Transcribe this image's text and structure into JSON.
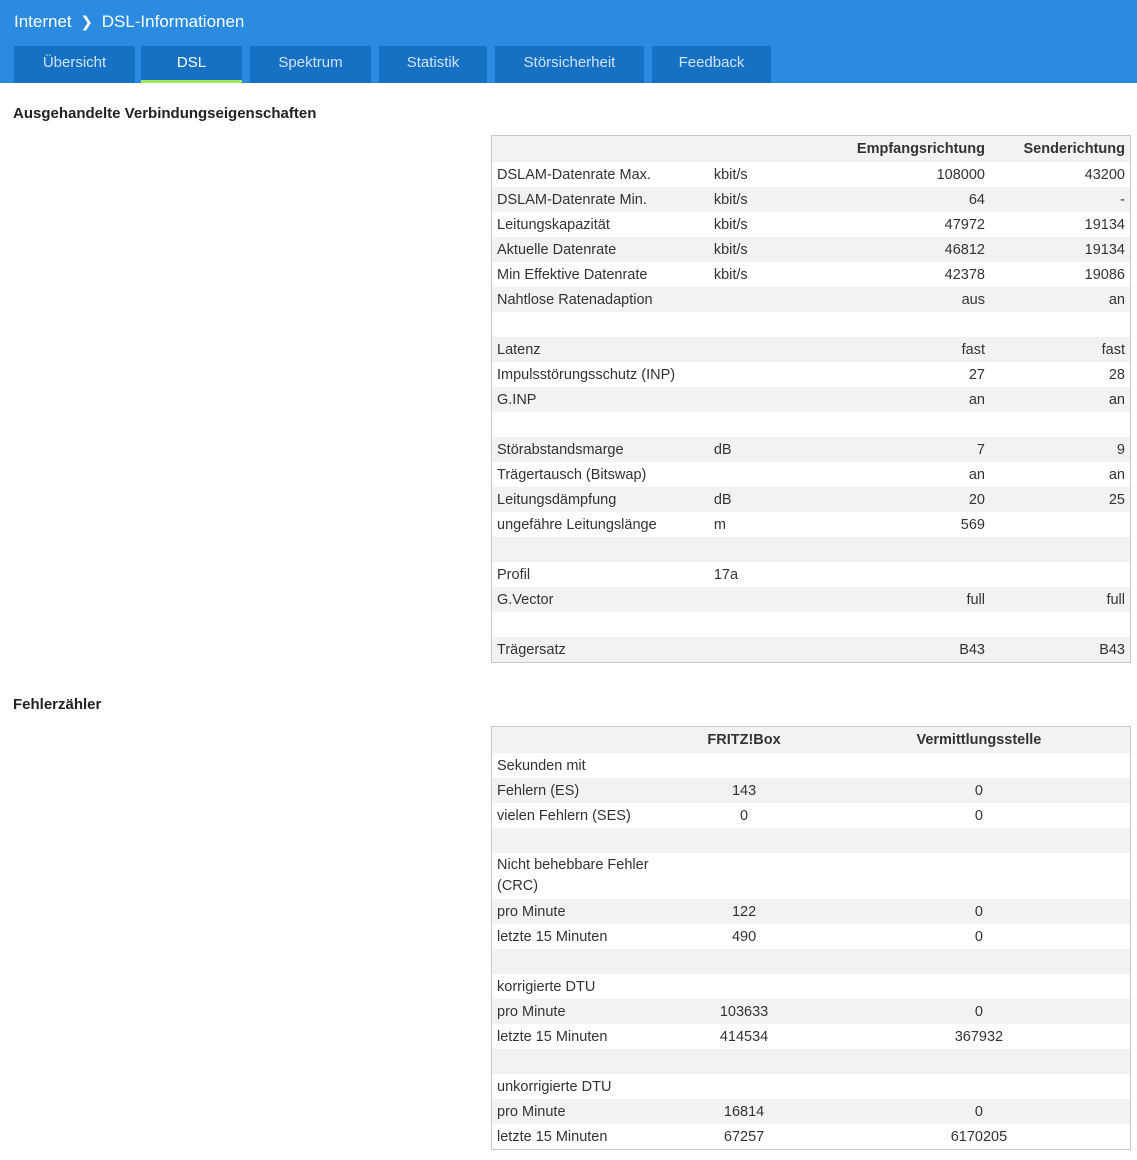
{
  "header": {
    "breadcrumb_root": "Internet",
    "breadcrumb_separator": "❯",
    "breadcrumb_current": "DSL-Informationen",
    "tabs": [
      {
        "label": "Übersicht",
        "active": false
      },
      {
        "label": "DSL",
        "active": true
      },
      {
        "label": "Spektrum",
        "active": false
      },
      {
        "label": "Statistik",
        "active": false
      },
      {
        "label": "Störsicherheit",
        "active": false
      },
      {
        "label": "Feedback",
        "active": false
      }
    ]
  },
  "colors": {
    "header_bg": "#2a8be0",
    "tab_bg": "#1671c4",
    "tab_active_underline": "#a5e85c",
    "row_stripe": "#f2f2f2"
  },
  "properties": {
    "title": "Ausgehandelte Verbindungseigenschaften",
    "col_recv": "Empfangsrichtung",
    "col_send": "Senderichtung",
    "rows": [
      {
        "label": "DSLAM-Datenrate Max.",
        "unit": "kbit/s",
        "recv": "108000",
        "send": "43200"
      },
      {
        "label": "DSLAM-Datenrate Min.",
        "unit": "kbit/s",
        "recv": "64",
        "send": "-"
      },
      {
        "label": "Leitungskapazität",
        "unit": "kbit/s",
        "recv": "47972",
        "send": "19134"
      },
      {
        "label": "Aktuelle Datenrate",
        "unit": "kbit/s",
        "recv": "46812",
        "send": "19134"
      },
      {
        "label": "Min Effektive Datenrate",
        "unit": "kbit/s",
        "recv": "42378",
        "send": "19086"
      },
      {
        "label": "Nahtlose Ratenadaption",
        "unit": "",
        "recv": "aus",
        "send": "an"
      },
      {
        "label": "",
        "unit": "",
        "recv": "",
        "send": ""
      },
      {
        "label": "Latenz",
        "unit": "",
        "recv": "fast",
        "send": "fast"
      },
      {
        "label": "Impulsstörungsschutz (INP)",
        "unit": "",
        "recv": "27",
        "send": "28"
      },
      {
        "label": "G.INP",
        "unit": "",
        "recv": "an",
        "send": "an"
      },
      {
        "label": "",
        "unit": "",
        "recv": "",
        "send": ""
      },
      {
        "label": "Störabstandsmarge",
        "unit": "dB",
        "recv": "7",
        "send": "9"
      },
      {
        "label": "Trägertausch (Bitswap)",
        "unit": "",
        "recv": "an",
        "send": "an"
      },
      {
        "label": "Leitungsdämpfung",
        "unit": "dB",
        "recv": "20",
        "send": "25"
      },
      {
        "label": "ungefähre Leitungslänge",
        "unit": "m",
        "recv": "569",
        "send": ""
      },
      {
        "label": "",
        "unit": "",
        "recv": "",
        "send": ""
      },
      {
        "label": "Profil",
        "unit": "17a",
        "recv": "",
        "send": ""
      },
      {
        "label": "G.Vector",
        "unit": "",
        "recv": "full",
        "send": "full"
      },
      {
        "label": "",
        "unit": "",
        "recv": "",
        "send": ""
      },
      {
        "label": "Trägersatz",
        "unit": "",
        "recv": "B43",
        "send": "B43"
      }
    ]
  },
  "errors": {
    "title": "Fehlerzähler",
    "col_fritzbox": "FRITZ!Box",
    "col_vst": "Vermittlungsstelle",
    "rows": [
      {
        "label": "Sekunden mit",
        "fritzbox": "",
        "vst": ""
      },
      {
        "label": "Fehlern (ES)",
        "fritzbox": "143",
        "vst": "0"
      },
      {
        "label": "vielen Fehlern (SES)",
        "fritzbox": "0",
        "vst": "0"
      },
      {
        "label": "",
        "fritzbox": "",
        "vst": ""
      },
      {
        "label": "Nicht behebbare Fehler (CRC)",
        "fritzbox": "",
        "vst": ""
      },
      {
        "label": "pro Minute",
        "fritzbox": "122",
        "vst": "0"
      },
      {
        "label": "letzte 15 Minuten",
        "fritzbox": "490",
        "vst": "0"
      },
      {
        "label": "",
        "fritzbox": "",
        "vst": ""
      },
      {
        "label": "korrigierte DTU",
        "fritzbox": "",
        "vst": ""
      },
      {
        "label": "pro Minute",
        "fritzbox": "103633",
        "vst": "0"
      },
      {
        "label": "letzte 15 Minuten",
        "fritzbox": "414534",
        "vst": "367932"
      },
      {
        "label": "",
        "fritzbox": "",
        "vst": ""
      },
      {
        "label": "unkorrigierte DTU",
        "fritzbox": "",
        "vst": ""
      },
      {
        "label": "pro Minute",
        "fritzbox": "16814",
        "vst": "0"
      },
      {
        "label": "letzte 15 Minuten",
        "fritzbox": "67257",
        "vst": "6170205"
      }
    ]
  }
}
